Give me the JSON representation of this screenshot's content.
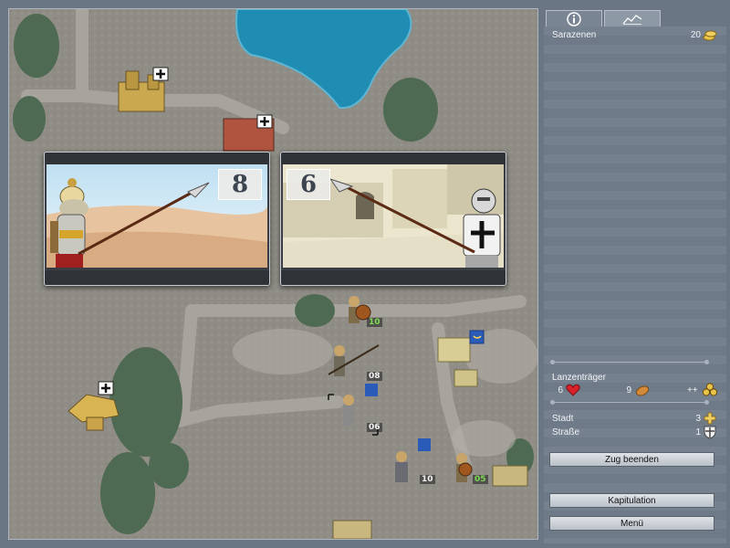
{
  "panel": {
    "tabs": [
      {
        "icon": "info-icon"
      },
      {
        "icon": "chart-icon"
      }
    ],
    "faction": {
      "name": "Sarazenen",
      "gold": "20"
    },
    "unit": {
      "name": "Lanzenträger",
      "health": "6",
      "food": "9",
      "upgrade": "++"
    },
    "stats": {
      "city_label": "Stadt",
      "city_value": "3",
      "road_label": "Straße",
      "road_value": "1"
    },
    "buttons": {
      "end_turn": "Zug beenden",
      "capitulate": "Kapitulation",
      "menu": "Menü"
    }
  },
  "battle": {
    "attacker_strength": "8",
    "defender_strength": "6"
  },
  "map_labels": {
    "u1": "10",
    "u2": "08",
    "u3": "06",
    "u4": "10",
    "u5": "05"
  },
  "colors": {
    "health": "#d8222a",
    "gold": "#e8c44a",
    "blue_flag": "#2a5bb8",
    "number_green": "#7ddc55"
  }
}
